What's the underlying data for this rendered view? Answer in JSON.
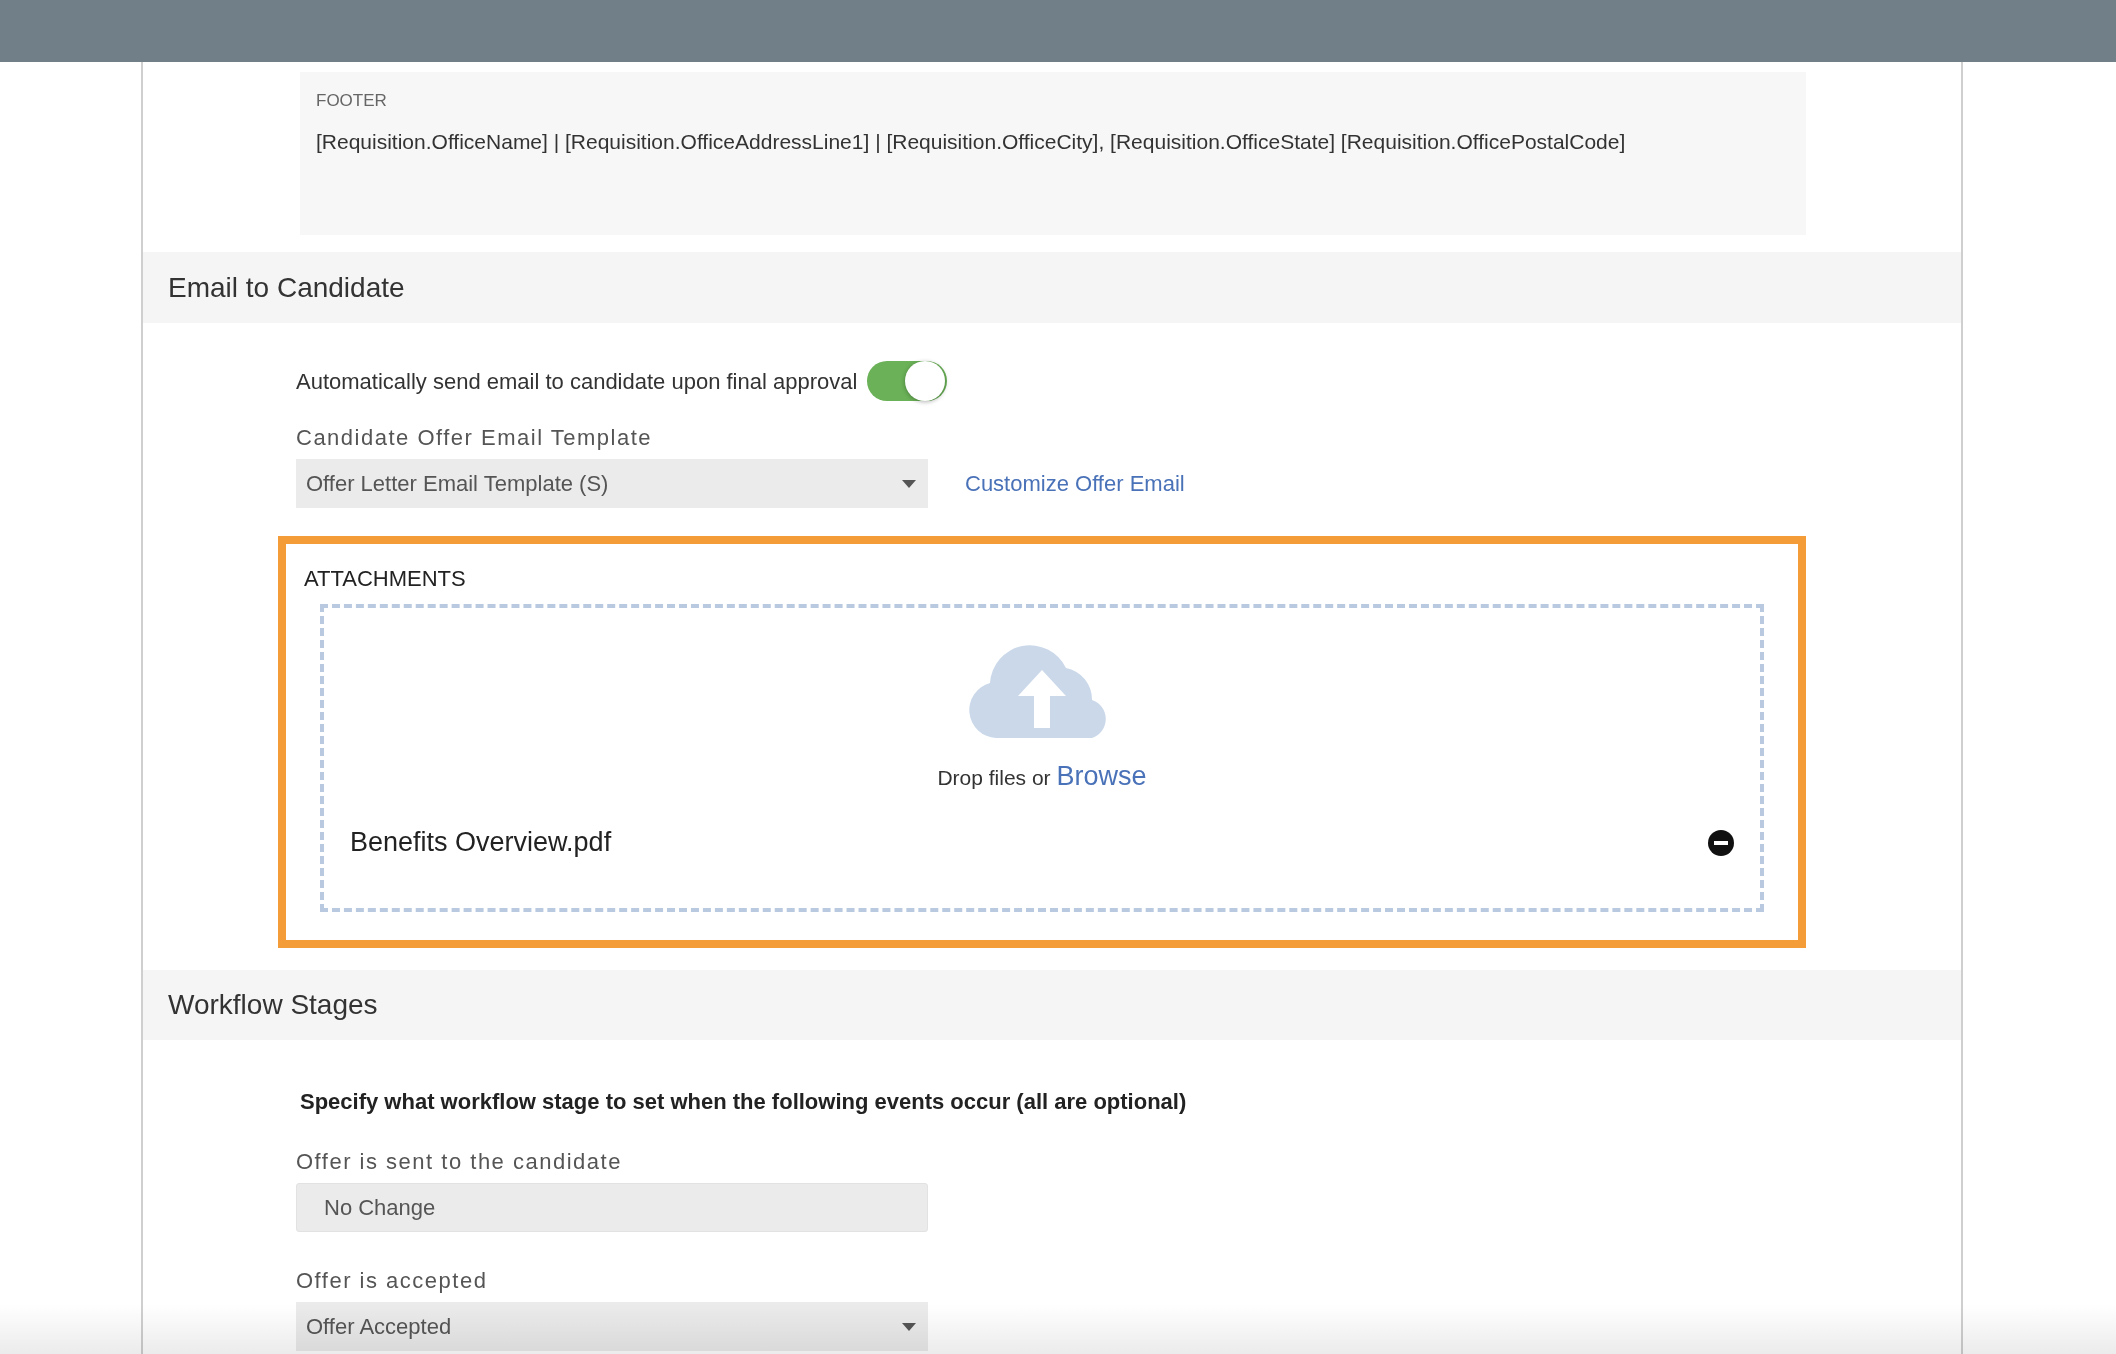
{
  "footer": {
    "label": "FOOTER",
    "text": "[Requisition.OfficeName] | [Requisition.OfficeAddressLine1] | [Requisition.OfficeCity], [Requisition.OfficeState] [Requisition.OfficePostalCode]"
  },
  "email_section": {
    "title": "Email to Candidate",
    "auto_send": {
      "label": "Automatically send email to candidate upon final approval",
      "on": true
    },
    "template": {
      "label": "Candidate Offer Email Template",
      "value": "Offer Letter Email Template (S)",
      "kind": "select"
    },
    "customize_link": "Customize Offer Email",
    "attachments": {
      "title": "ATTACHMENTS",
      "highlighted": true,
      "drop_text": "Drop files or",
      "browse_link": "Browse",
      "files": [
        {
          "name": "Benefits Overview.pdf"
        }
      ]
    }
  },
  "workflow_section": {
    "title": "Workflow Stages",
    "instruction": "Specify what workflow stage to set when the following events occur (all are optional)",
    "fields": [
      {
        "label": "Offer is sent to the candidate",
        "value": "No Change",
        "kind": "text"
      },
      {
        "label": "Offer is accepted",
        "value": "Offer Accepted",
        "kind": "select"
      }
    ]
  }
}
